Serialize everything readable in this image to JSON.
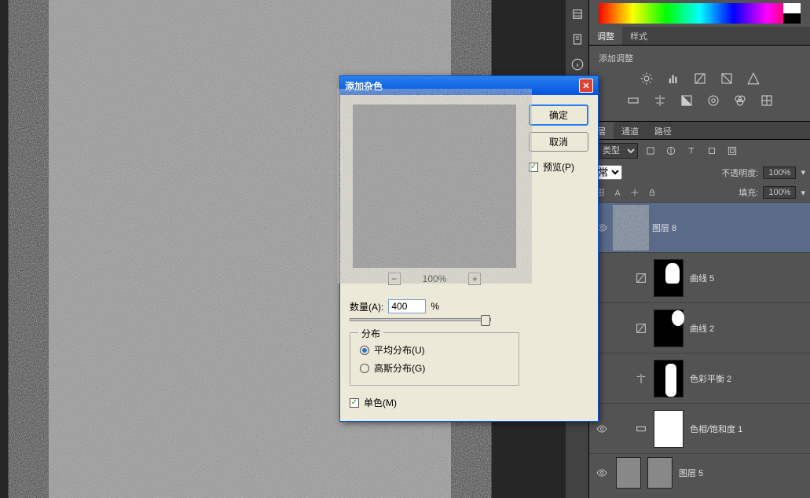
{
  "dialog": {
    "title": "添加杂色",
    "ok_label": "确定",
    "cancel_label": "取消",
    "preview_label": "预览(P)",
    "zoom_value": "100%",
    "amount_label": "数量(A):",
    "amount_value": "400",
    "amount_suffix": "%",
    "distribution_legend": "分布",
    "uniform_label": "平均分布(U)",
    "gaussian_label": "高斯分布(G)",
    "monochrome_label": "单色(M)"
  },
  "panels": {
    "tab_adjust": "调整",
    "tab_styles": "样式",
    "add_adjustment": "添加调整",
    "tab_layers": "层",
    "tab_channels": "通道",
    "tab_paths": "路径",
    "type_label": "类型",
    "blend_mode": "常",
    "opacity_label": "不透明度:",
    "opacity_value": "100%",
    "fill_label": "填充:",
    "fill_value": "100%"
  },
  "layers": [
    {
      "name": "图层 8"
    },
    {
      "name": "曲线 5"
    },
    {
      "name": "曲线 2"
    },
    {
      "name": "色彩平衡 2"
    },
    {
      "name": "色相/饱和度 1"
    },
    {
      "name": "图层 5"
    }
  ]
}
